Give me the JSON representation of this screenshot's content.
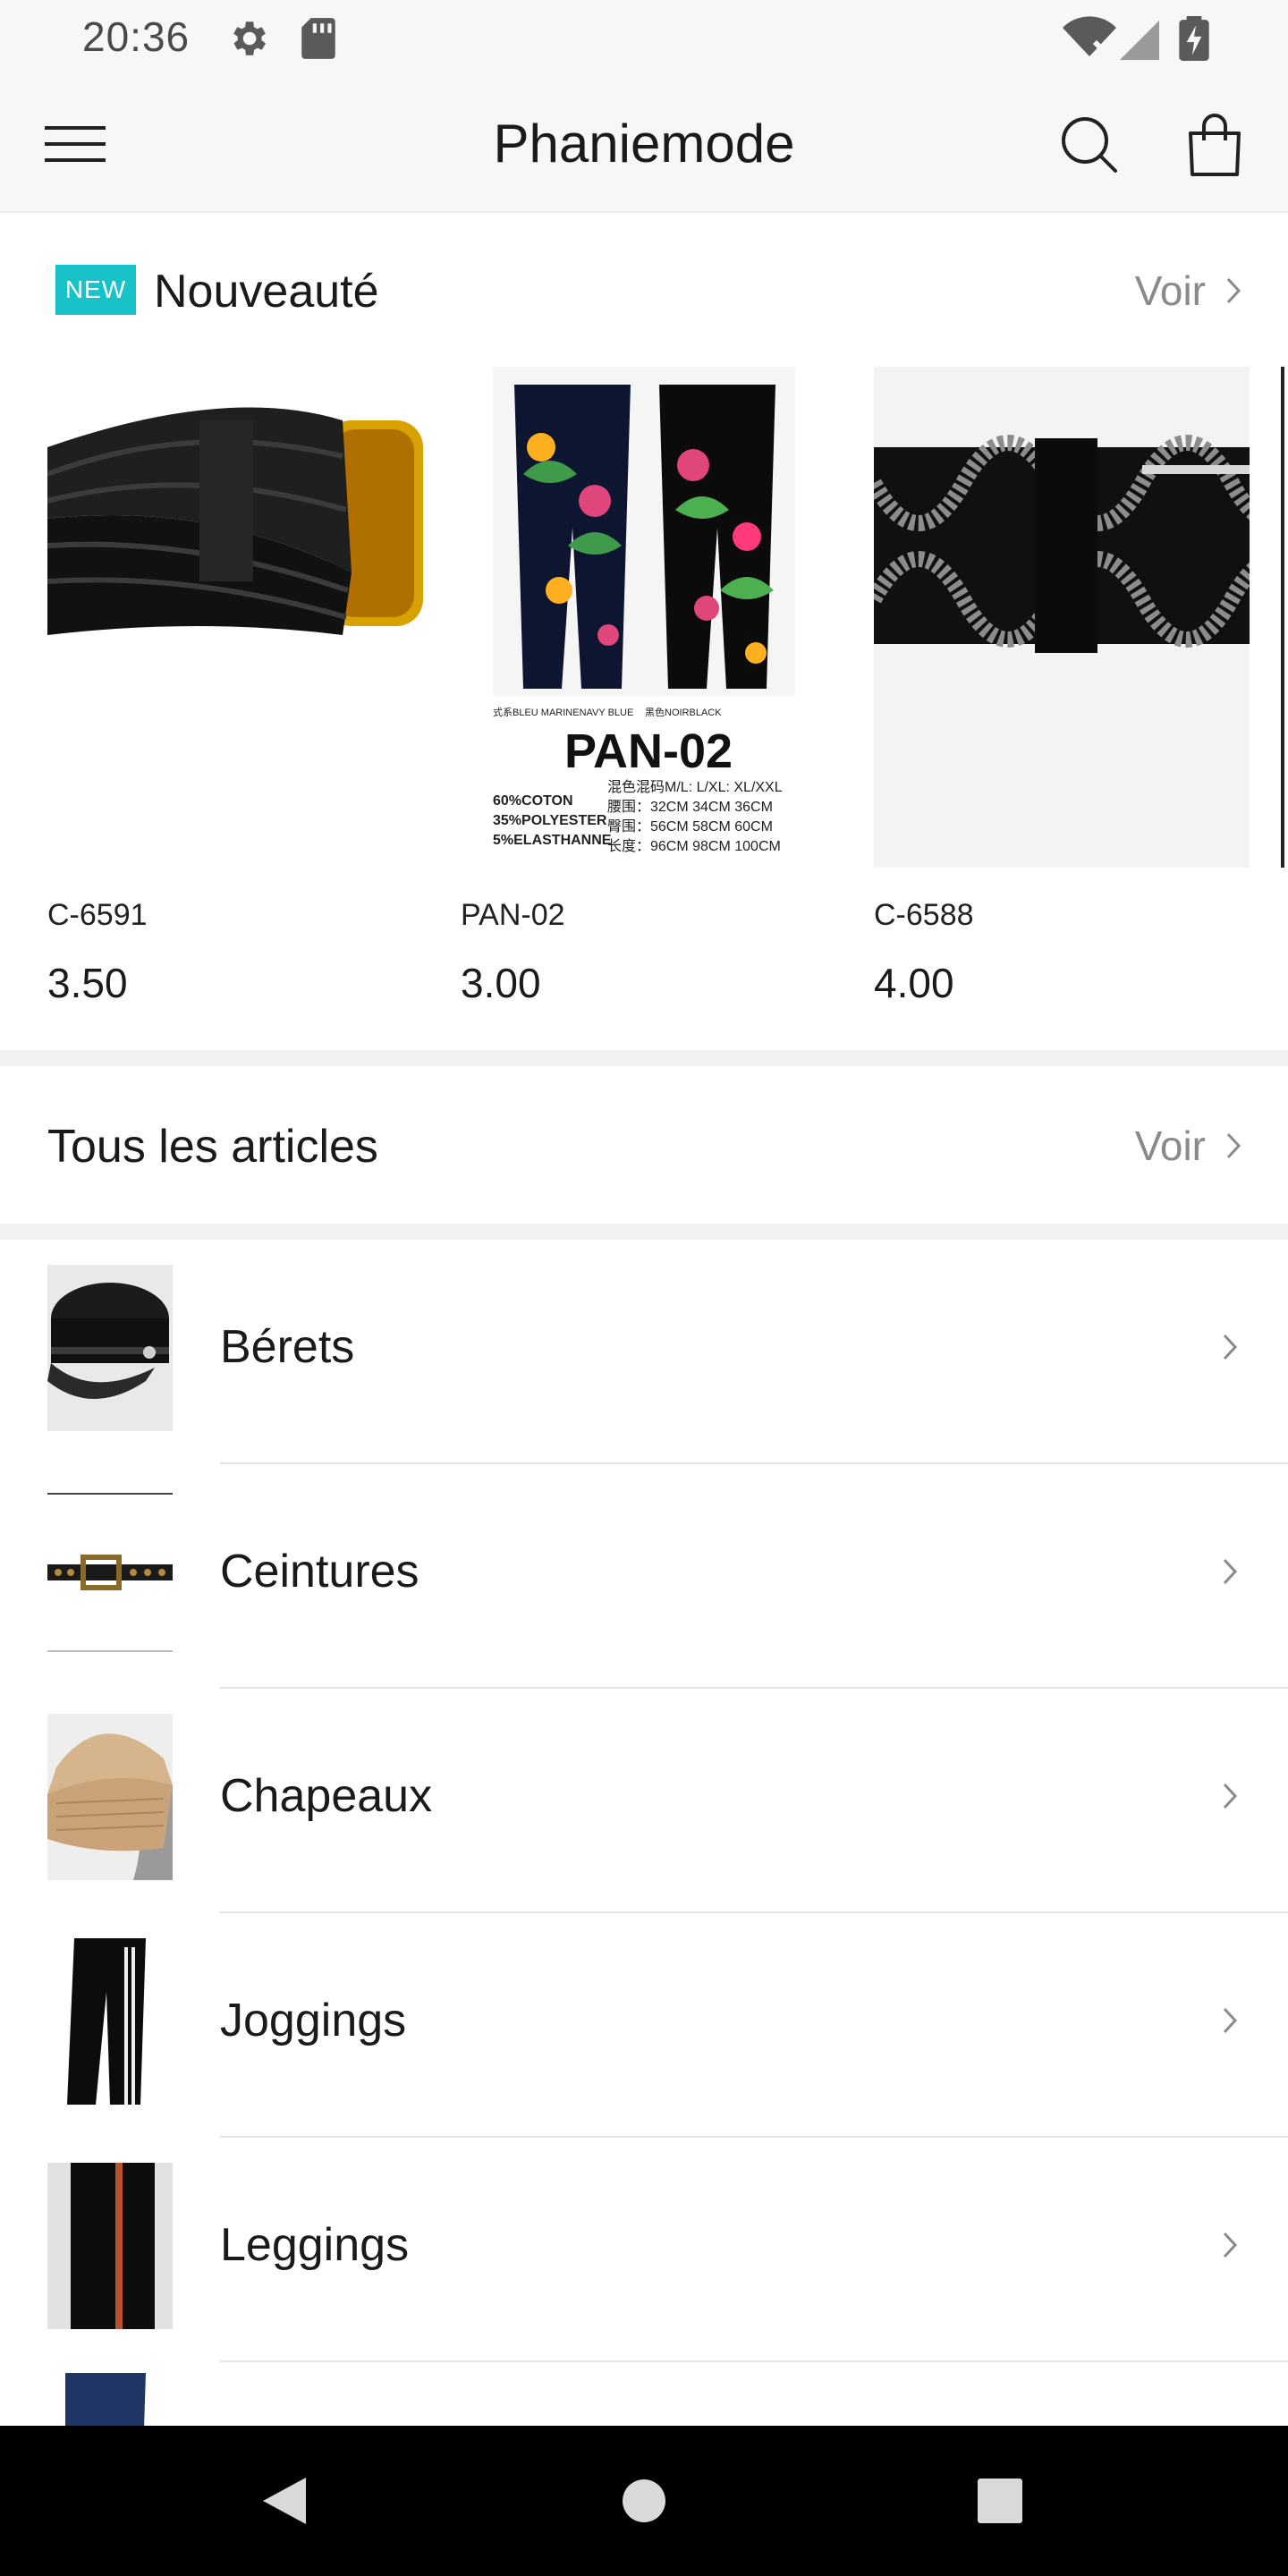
{
  "status_bar": {
    "time": "20:36",
    "icons": [
      "settings-icon",
      "sd-card-icon",
      "wifi-off-icon",
      "signal-icon",
      "battery-charging-icon"
    ]
  },
  "header": {
    "title": "Phaniemode",
    "menu_icon": "hamburger-menu-icon",
    "search_icon": "search-icon",
    "cart_icon": "shopping-bag-icon"
  },
  "new_section": {
    "badge": "NEW",
    "title": "Nouveauté",
    "see_all": "Voir",
    "products": [
      {
        "code": "C-6591",
        "price": "3.50",
        "image": "black braided belt"
      },
      {
        "code": "PAN-02",
        "price": "3.00",
        "image": "floral pants",
        "image_text": {
          "variant_left": "式系BLEU MARINENAVY BLUE",
          "variant_right": "黑色NOIRBLACK",
          "model": "PAN-02",
          "composition": [
            "60%COTON",
            "35%POLYESTER",
            "5%ELASTHANNE"
          ],
          "sizes_label": "混色混码M/L: L/XL: XL/XXL",
          "size_rows": [
            "腰围：32CM 34CM 36CM",
            "臀围：56CM 58CM 60CM",
            "长度：96CM 98CM 100CM"
          ]
        }
      },
      {
        "code": "C-6588",
        "price": "4.00",
        "image": "black and silver braided belt"
      }
    ]
  },
  "all_articles": {
    "title": "Tous les articles",
    "see_all": "Voir"
  },
  "categories": [
    {
      "label": "Bérets",
      "thumb": "beret"
    },
    {
      "label": "Ceintures",
      "thumb": "belt"
    },
    {
      "label": "Chapeaux",
      "thumb": "hat"
    },
    {
      "label": "Joggings",
      "thumb": "joggers"
    },
    {
      "label": "Leggings",
      "thumb": "leggings"
    },
    {
      "label": "",
      "thumb": "jeans"
    }
  ],
  "colors": {
    "accent_badge": "#17c3c8",
    "muted_text": "#8a8a8a",
    "background_bar": "#f7f7f7"
  },
  "nav_bar": {
    "back_icon": "back-triangle-icon",
    "home_icon": "home-circle-icon",
    "recents_icon": "recents-square-icon"
  }
}
